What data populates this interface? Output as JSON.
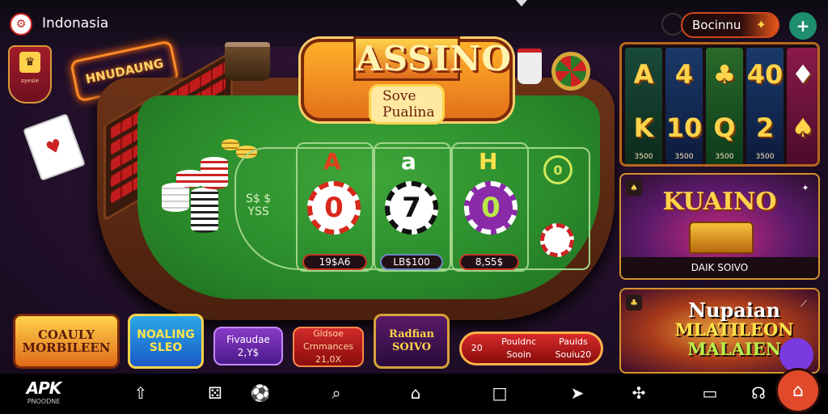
{
  "header": {
    "region": "Indonasia",
    "bonus_label": "Bocinnu",
    "bonus_star": "✦",
    "action_symbol": "+"
  },
  "left_deco": {
    "shield_text": "syesie",
    "neon_sign": "HNUDAUNG"
  },
  "logo": {
    "title": "ASSINO",
    "subtitle": "Sove Pualina"
  },
  "table": {
    "side_text_1": "S$ $",
    "side_text_2": "YSS",
    "bets": [
      {
        "letter": "A",
        "chip": "0",
        "amount": "19$A6",
        "letter_color": "#e0401a",
        "chip_color": "#d8281a"
      },
      {
        "letter": "a",
        "chip": "7",
        "amount": "LB$100",
        "letter_color": "#ffffff",
        "chip_color": "#111111"
      },
      {
        "letter": "H",
        "chip": "0",
        "amount": "8,S5$",
        "letter_color": "#ffe34a",
        "chip_color": "#8a2aa8"
      }
    ],
    "circle_marker": "0"
  },
  "slots": {
    "reels": [
      {
        "top": "A",
        "bottom": "K",
        "value": "3500"
      },
      {
        "top": "4",
        "bottom": "10",
        "value": "3500"
      },
      {
        "top": "♣",
        "bottom": "Q",
        "value": "3500"
      },
      {
        "top": "40",
        "bottom": "2",
        "value": "3500"
      },
      {
        "top": "♦",
        "bottom": "♠",
        "value": ""
      }
    ]
  },
  "promos": {
    "promo1_title": "KUAINO",
    "promo1_sub": "DAIK SOIVO",
    "promo2_title_1": "Nupaian",
    "promo2_title_2": "MLATILEON",
    "promo2_title_3": "MALAIEN"
  },
  "tiles": {
    "t1_line1": "COAULY",
    "t1_line2": "MORBILEEN",
    "t2_line1": "NOALING",
    "t2_line2": "SLEO",
    "t3_line1": "Fivaudae",
    "t3_line2": "2,Y$",
    "t4_line1": "Gldsoe",
    "t4_line2": "Crnmances",
    "t4_line3": "21,0X",
    "t5_line1": "Radfian",
    "t5_line2": "SOIVO",
    "t6_prefix": "20",
    "t6_a1": "Pouldnc",
    "t6_a2": "Sooin",
    "t6_b1": "Paulds",
    "t6_b2": "Souiu20"
  },
  "bottom": {
    "brand": "APK",
    "brand_sub": "PNOODNE",
    "nav_icons": [
      "home-outline-icon",
      "dice-icon",
      "soccer-icon",
      "search-icon",
      "house-icon",
      "square-icon",
      "send-icon",
      "fish-icon",
      "rectangle-icon",
      "headset-icon"
    ],
    "fab_symbol": "⌂"
  }
}
